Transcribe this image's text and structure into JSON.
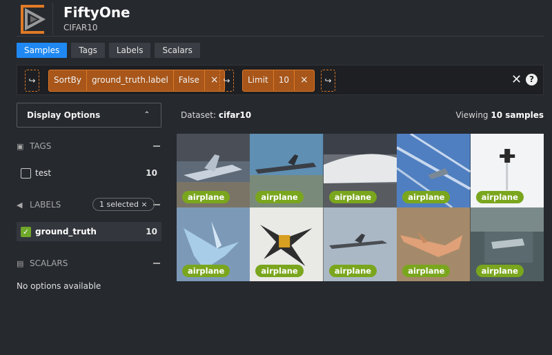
{
  "app": {
    "title": "FiftyOne",
    "dataset_name": "CIFAR10"
  },
  "tabs": [
    {
      "label": "Samples",
      "active": true
    },
    {
      "label": "Tags",
      "active": false
    },
    {
      "label": "Labels",
      "active": false
    },
    {
      "label": "Scalars",
      "active": false
    }
  ],
  "view_bar": {
    "add_stage_glyph": "↪",
    "stages": [
      {
        "name": "SortBy",
        "params": [
          "ground_truth.label",
          "False"
        ]
      },
      {
        "name": "Limit",
        "params": [
          "10"
        ]
      }
    ],
    "remove_glyph": "×",
    "close_glyph": "✕",
    "help_glyph": "?"
  },
  "sidebar": {
    "display_options_label": "Display Options",
    "tags": {
      "title": "TAGS",
      "items": [
        {
          "label": "test",
          "count": "10",
          "checked": false
        }
      ]
    },
    "labels": {
      "title": "LABELS",
      "selected_pill": "1 selected ×",
      "items": [
        {
          "label": "ground_truth",
          "count": "10",
          "checked": true
        }
      ]
    },
    "scalars": {
      "title": "SCALARS",
      "empty_text": "No options available"
    }
  },
  "main": {
    "dataset_prefix": "Dataset:",
    "dataset_value": "cifar10",
    "viewing_prefix": "Viewing",
    "viewing_value": "10 samples"
  },
  "samples": [
    {
      "label": "airplane",
      "bg": "#5e6a78"
    },
    {
      "label": "airplane",
      "bg": "#5f8fb3"
    },
    {
      "label": "airplane",
      "bg": "#6a6f77"
    },
    {
      "label": "airplane",
      "bg": "#4f7fc0"
    },
    {
      "label": "airplane",
      "bg": "#f2f4f6"
    },
    {
      "label": "airplane",
      "bg": "#7c9ab8"
    },
    {
      "label": "airplane",
      "bg": "#e9e9e6"
    },
    {
      "label": "airplane",
      "bg": "#aab8c6"
    },
    {
      "label": "airplane",
      "bg": "#a48a6a"
    },
    {
      "label": "airplane",
      "bg": "#4e5e60"
    }
  ],
  "colors": {
    "accent": "#1f88f2",
    "stage": "#e07a26",
    "label_tag": "#7aa61e",
    "check": "#6fa82a"
  }
}
